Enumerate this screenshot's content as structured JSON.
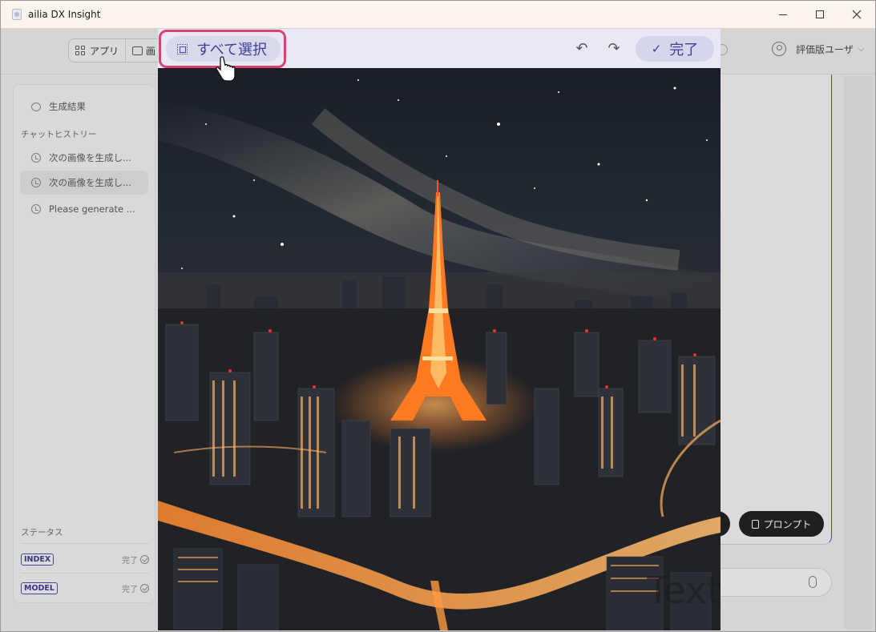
{
  "window": {
    "title": "ailia DX Insight"
  },
  "topbar": {
    "tab_apps": "アプリ",
    "tab_image": "画",
    "user_label": "評価版ユーザ"
  },
  "sidebar": {
    "results_label": "生成結果",
    "history_heading": "チャットヒストリー",
    "history": [
      {
        "label": "次の画像を生成し..."
      },
      {
        "label": "次の画像を生成し..."
      },
      {
        "label": "Please generate ..."
      }
    ],
    "status_heading": "ステータス",
    "status": [
      {
        "badge": "INDEX",
        "state": "完了"
      },
      {
        "badge": "MODEL",
        "state": "完了"
      }
    ]
  },
  "main": {
    "prompt_button": "プロンプト",
    "watermark_text": "Text"
  },
  "editor": {
    "select_all_label": "すべて選択",
    "done_label": "完了",
    "undo_glyph": "↶",
    "redo_glyph": "↷",
    "image_subject": "night-city-tower-milky-way"
  },
  "colors": {
    "accent": "#3e3e9a",
    "highlight": "#d9416f",
    "tower": "#ff8a2a"
  }
}
